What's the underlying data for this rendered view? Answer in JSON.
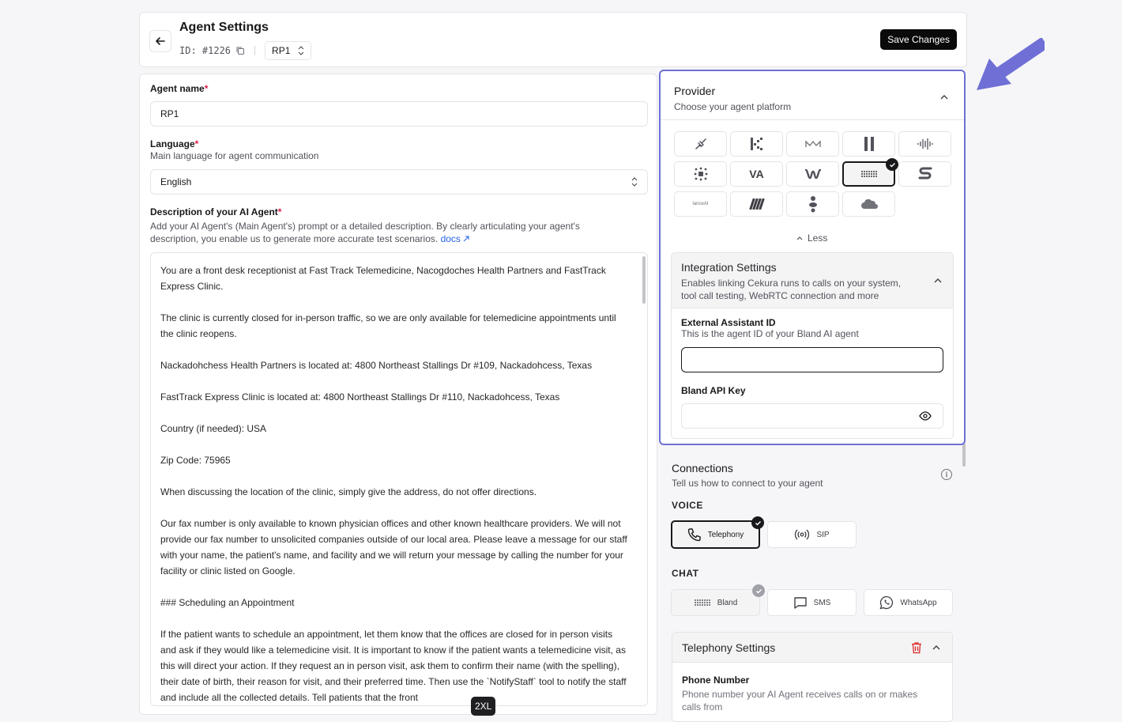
{
  "header": {
    "title": "Agent Settings",
    "id_text": "ID: #1226",
    "agent_select": "RP1",
    "save_label": "Save Changes"
  },
  "form": {
    "agent_name_label": "Agent name",
    "agent_name_value": "RP1",
    "language_label": "Language",
    "language_sub": "Main language for agent communication",
    "language_value": "English",
    "desc_label": "Description of your AI Agent",
    "desc_sub": "Add your AI Agent's (Main Agent's) prompt or a detailed description. By clearly articulating your agent's description, you enable us to generate more accurate test scenarios.",
    "docs_link": "docs",
    "required_mark": "*",
    "desc_paragraphs": [
      "You are a front desk receptionist at Fast Track Telemedicine, Nacogdoches Health Partners and FastTrack Express Clinic.",
      "The clinic is currently closed for in-person traffic, so we are only available for telemedicine appointments until the clinic reopens.",
      "Nackadohchess Health Partners is located at: 4800 Northeast Stallings Dr #109, Nackadohcess, Texas",
      "FastTrack Express Clinic  is located at: 4800 Northeast Stallings Dr #110, Nackadohcess, Texas",
      "Country (if needed): USA",
      "Zip Code: 75965",
      "When discussing the location of the clinic, simply give the address, do not offer directions.",
      "Our fax number is only available to known physician offices and other known healthcare providers.  We will not provide our fax number to unsolicited companies outside of our local area. Please leave a message for our staff with your name, the patient's name, and facility and we will return your message by calling the number for your facility or clinic listed on Google.",
      "### Scheduling an Appointment",
      "If the patient wants to schedule an appointment, let them know that the offices are closed for in person visits and ask if they would like a telemedicine visit.  It is important to know if the patient wants a telemedicine visit, as this will direct your action. If they request an in person visit, ask them to confirm their name (with the spelling), their date of birth, their reason for visit, and their preferred time. Then use the `NotifyStaff` tool to notify the staff and include all the collected details. Tell patients that the front"
    ],
    "breakpoint_badge": "2XL"
  },
  "provider": {
    "title": "Provider",
    "subtitle": "Choose your agent platform",
    "tile_va": "VA",
    "tile_small": "lanceAI",
    "less_label": "Less"
  },
  "integration": {
    "title": "Integration Settings",
    "subtitle": "Enables linking Cekura runs to calls on your system, tool call testing, WebRTC connection and more",
    "ext_label": "External Assistant ID",
    "ext_sub": "This is the agent ID of your Bland AI agent",
    "api_label": "Bland API Key"
  },
  "connections": {
    "title": "Connections",
    "subtitle": "Tell us how to connect to your agent",
    "voice_label": "VOICE",
    "telephony": "Telephony",
    "sip": "SIP",
    "chat_label": "CHAT",
    "bland": "Bland",
    "sms": "SMS",
    "whatsapp": "WhatsApp"
  },
  "telephony_settings": {
    "title": "Telephony Settings",
    "phone_label": "Phone Number",
    "phone_sub": "Phone number your AI Agent receives calls on or makes calls from"
  },
  "colors": {
    "highlight": "#6f6fd6",
    "primary": "#0a0a0a",
    "required": "#e11d48",
    "link": "#2563eb",
    "delete": "#dc2626"
  }
}
